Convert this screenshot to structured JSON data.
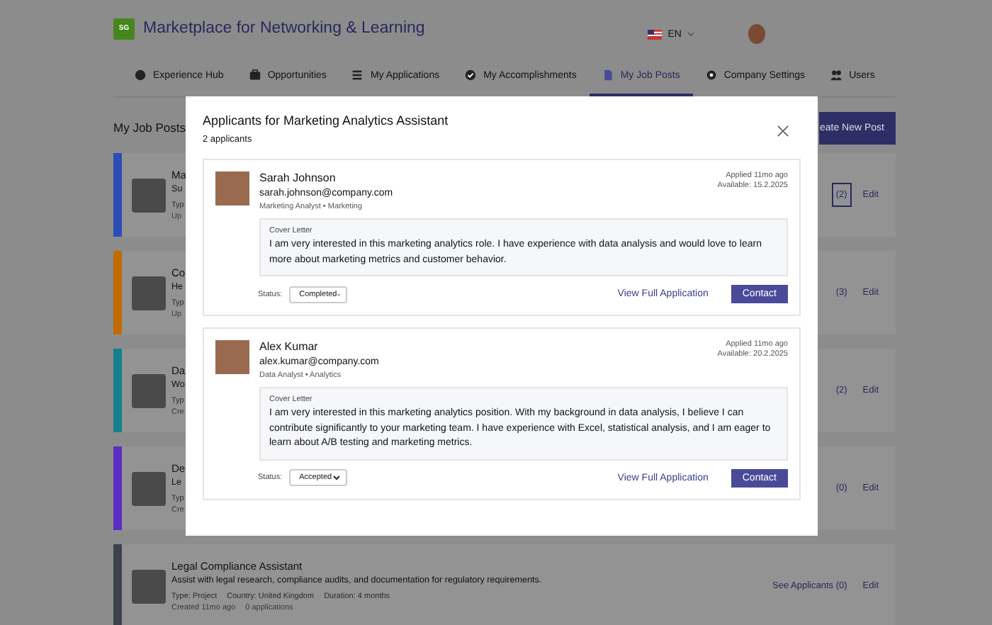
{
  "header": {
    "logo": "SG",
    "title": "Marketplace for Networking & Learning",
    "language": "EN"
  },
  "nav": [
    {
      "label": "Experience Hub",
      "selected": false
    },
    {
      "label": "Opportunities",
      "selected": false
    },
    {
      "label": "My Applications",
      "selected": false
    },
    {
      "label": "My Accomplishments",
      "selected": false
    },
    {
      "label": "My Job Posts",
      "selected": true
    },
    {
      "label": "Company Settings",
      "selected": false
    },
    {
      "label": "Users",
      "selected": false
    }
  ],
  "page": {
    "heading": "My Job Posts",
    "create_button": "eate New Post"
  },
  "posts": [
    {
      "color": "#2b4db8",
      "title": "Ma",
      "description": "Su",
      "meta": [
        "Typ"
      ],
      "footer": [
        "Up"
      ],
      "applicants_button": "(2)",
      "selected": true,
      "edit": "Edit"
    },
    {
      "color": "#c26b00",
      "title": "Co",
      "description": "He",
      "meta": [
        "Typ"
      ],
      "footer": [
        "Up"
      ],
      "applicants_button": "(3)",
      "selected": false,
      "edit": "Edit"
    },
    {
      "color": "#12808e",
      "title": "Da",
      "description": "Wo",
      "meta": [
        "Typ"
      ],
      "footer": [
        "Cre"
      ],
      "applicants_button": "(2)",
      "selected": false,
      "edit": "Edit"
    },
    {
      "color": "#5b2dc2",
      "title": "De",
      "description": "Le",
      "meta": [
        "Typ"
      ],
      "footer": [
        "Cre"
      ],
      "applicants_button": "(0)",
      "selected": false,
      "edit": "Edit"
    },
    {
      "color": "#3b414d",
      "title": "Legal Compliance Assistant",
      "description": "Assist with legal research, compliance audits, and documentation for regulatory requirements.",
      "meta": [
        "Type: Project",
        "Country: United Kingdom",
        "Duration: 4 months"
      ],
      "footer": [
        "Created 11mo ago",
        "0 applications"
      ],
      "applicants_button": "See Applicants (0)",
      "selected": false,
      "edit": "Edit"
    }
  ],
  "modal": {
    "title": "Applicants for Marketing Analytics Assistant",
    "subtitle": "2 applicants",
    "applicants": [
      {
        "name": "Sarah Johnson",
        "email": "sarah.johnson@company.com",
        "role": "Marketing Analyst • Marketing",
        "applied": "Applied 11mo ago",
        "available": "Available: 15.2.2025",
        "cover_label": "Cover Letter",
        "cover_text": "I am very interested in this marketing analytics role. I have experience with data analysis and would love to learn more about marketing metrics and customer behavior.",
        "status_label": "Status:",
        "status": "Completed",
        "view_link": "View Full Application",
        "contact": "Contact"
      },
      {
        "name": "Alex Kumar",
        "email": "alex.kumar@company.com",
        "role": "Data Analyst • Analytics",
        "applied": "Applied 11mo ago",
        "available": "Available: 20.2.2025",
        "cover_label": "Cover Letter",
        "cover_text": "I am very interested in this marketing analytics position. With my background in data analysis, I believe I can contribute significantly to your marketing team. I have experience with Excel, statistical analysis, and I am eager to learn about A/B testing and marketing metrics.",
        "status_label": "Status:",
        "status": "Accepted",
        "view_link": "View Full Application",
        "contact": "Contact"
      }
    ]
  }
}
